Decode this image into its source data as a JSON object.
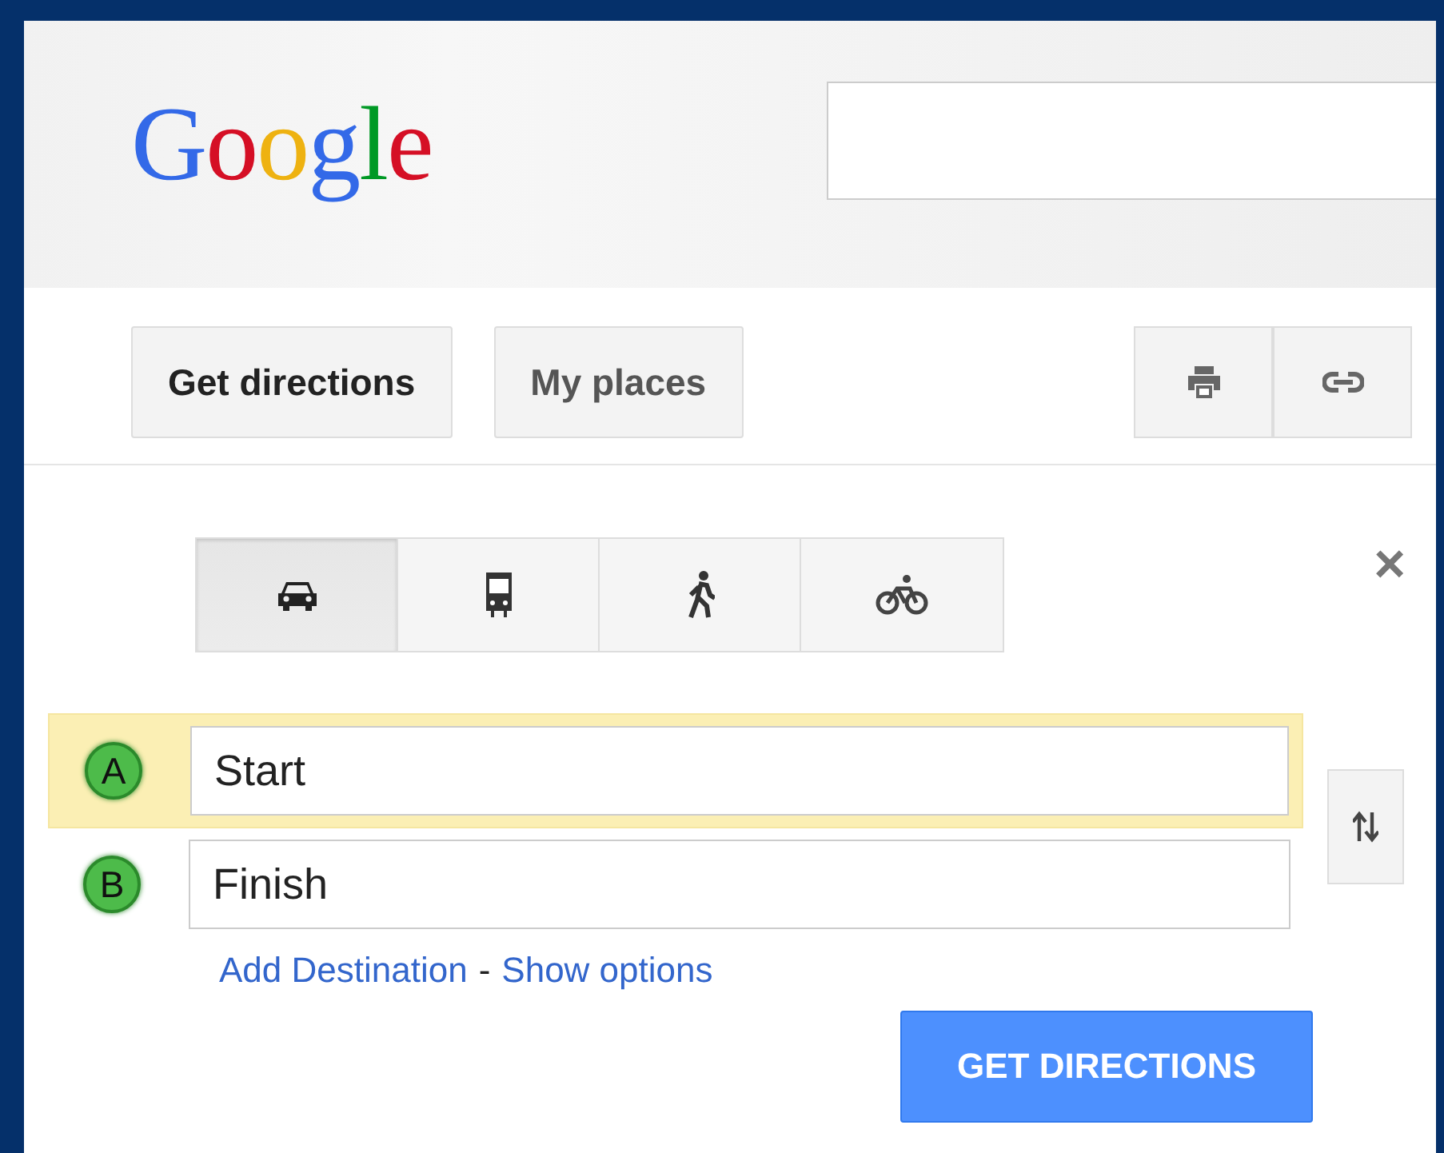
{
  "header": {
    "logo": "Google"
  },
  "toolbar": {
    "buttons": [
      {
        "label": "Get directions",
        "selected": true
      },
      {
        "label": "My places",
        "selected": false
      }
    ],
    "tools": [
      {
        "kind": "print"
      },
      {
        "kind": "link"
      }
    ]
  },
  "directions": {
    "close": "×",
    "modes": [
      {
        "kind": "car",
        "selected": true
      },
      {
        "kind": "transit",
        "selected": false
      },
      {
        "kind": "walk",
        "selected": false
      },
      {
        "kind": "bike",
        "selected": false
      }
    ],
    "waypoints": [
      {
        "marker": "A",
        "value": "Start",
        "selected": true
      },
      {
        "marker": "B",
        "value": "Finish",
        "selected": false
      }
    ],
    "links": [
      "Add Destination",
      "Show options"
    ],
    "separator": "-",
    "submit": "GET DIRECTIONS"
  }
}
